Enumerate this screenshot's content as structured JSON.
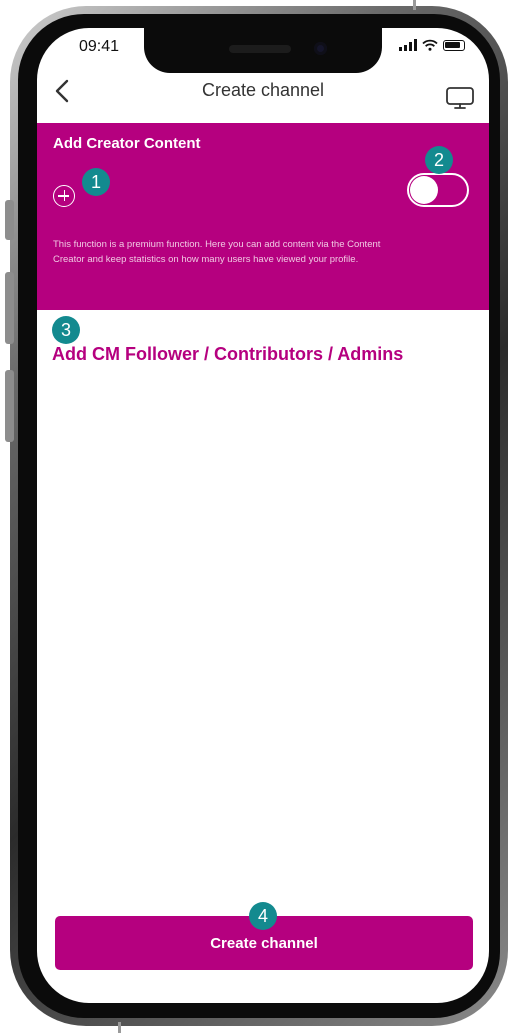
{
  "status_bar": {
    "time": "09:41"
  },
  "header": {
    "title": "Create channel",
    "back_icon": "chevron-left-icon",
    "action_icon": "monitor-icon"
  },
  "creator_content": {
    "title": "Add Creator Content",
    "add_icon": "plus-circle-icon",
    "toggle_on": false,
    "description": "This function is a premium function. Here you can add content via the Content Creator and keep statistics on how many users have viewed your profile."
  },
  "members_section": {
    "title": "Add CM Follower / Contributors / Admins"
  },
  "footer": {
    "create_label": "Create channel"
  },
  "annotations": [
    "1",
    "2",
    "3",
    "4"
  ],
  "colors": {
    "accent": "#b5007f",
    "marker": "#138a8f",
    "text": "#333333"
  }
}
